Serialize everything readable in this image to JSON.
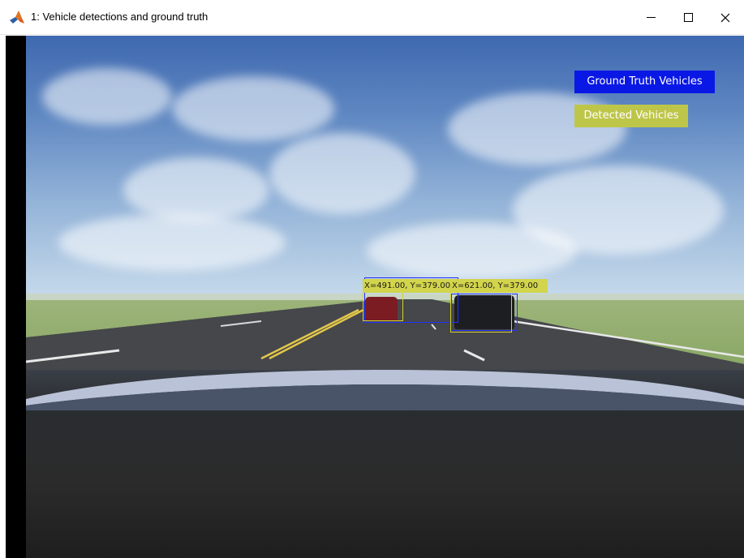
{
  "window": {
    "title": "1: Vehicle detections and ground truth",
    "app_icon": "matlab-icon",
    "controls": {
      "minimize_icon": "minimize-icon",
      "maximize_icon": "maximize-icon",
      "close_icon": "close-icon",
      "close_glyph": "✕"
    }
  },
  "legend": {
    "ground_truth": "Ground Truth Vehicles",
    "detected": "Detected Vehicles",
    "ground_truth_color": "#0a18e6",
    "detected_color": "#bec64a"
  },
  "detections": [
    {
      "label": "X=491.00, Y=379.00"
    },
    {
      "label": "X=621.00, Y=379.00"
    }
  ]
}
